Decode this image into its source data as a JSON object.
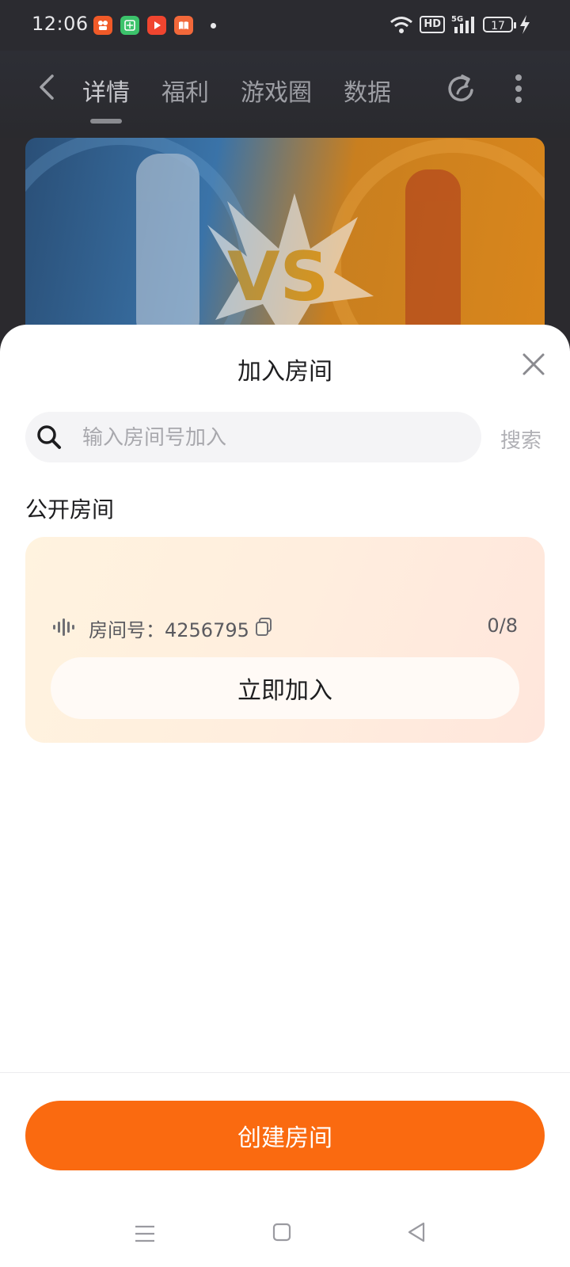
{
  "status_bar": {
    "time": "12:06",
    "hd_label": "HD",
    "battery_level": "17",
    "app_icons": [
      "kuaishou-icon",
      "calculator-icon",
      "video-play-icon",
      "book-icon"
    ]
  },
  "top_nav": {
    "tabs": [
      {
        "label": "详情",
        "active": true
      },
      {
        "label": "福利",
        "active": false
      },
      {
        "label": "游戏圈",
        "active": false
      },
      {
        "label": "数据",
        "active": false
      }
    ]
  },
  "sheet": {
    "title": "加入房间",
    "search": {
      "placeholder": "输入房间号加入",
      "value": "",
      "button_label": "搜索"
    },
    "section_title": "公开房间",
    "rooms": [
      {
        "label": "房间号：4256795",
        "occupancy": "0/8",
        "join_label": "立即加入"
      }
    ],
    "create_label": "创建房间"
  },
  "colors": {
    "accent": "#fa6a10",
    "card_gradient_start": "#fff3df",
    "card_gradient_end": "#ffe6dc",
    "dark_header": "#2b2b30"
  }
}
